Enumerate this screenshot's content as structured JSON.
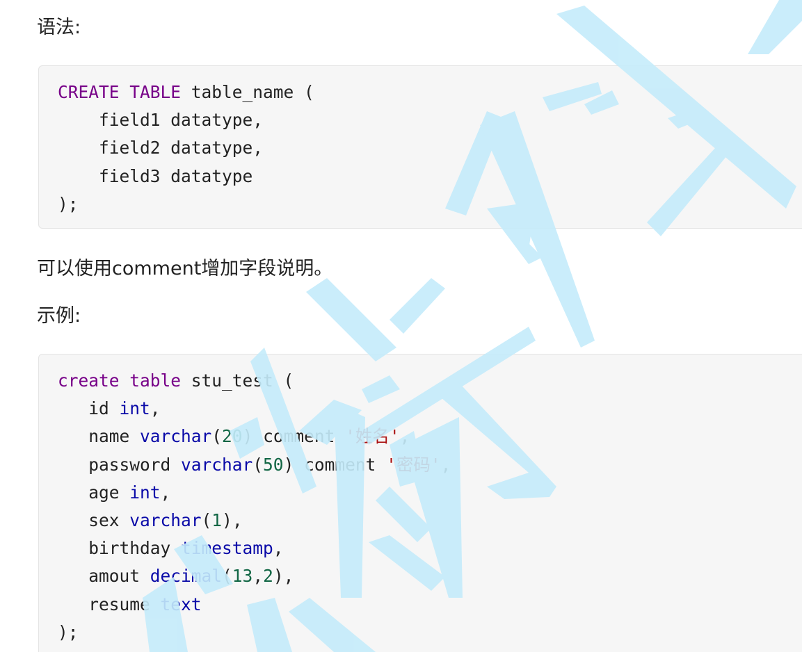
{
  "syntax_heading": "语法:",
  "syntax_code": {
    "line1": {
      "kw1": "CREATE",
      "kw2": "TABLE",
      "rest": " table_name ("
    },
    "line2": "    field1 datatype,",
    "line3": "    field2 datatype,",
    "line4": "    field3 datatype",
    "line5": ");"
  },
  "comment_note": "可以使用comment增加字段说明。",
  "example_heading": "示例:",
  "example_code": {
    "l1": {
      "kw1": "create",
      "kw2": "table",
      "rest": " stu_test ("
    },
    "l2": {
      "name": "   id ",
      "type": "int",
      "tail": ","
    },
    "l3": {
      "name": "   name ",
      "type": "varchar",
      "p1": "(",
      "num": "20",
      "p2": ") comment ",
      "str": "'姓名'",
      "tail": ","
    },
    "l4": {
      "name": "   password ",
      "type": "varchar",
      "p1": "(",
      "num": "50",
      "p2": ") comment ",
      "str": "'密码'",
      "tail": ","
    },
    "l5": {
      "name": "   age ",
      "type": "int",
      "tail": ","
    },
    "l6": {
      "name": "   sex ",
      "type": "varchar",
      "p1": "(",
      "num": "1",
      "p2": "),"
    },
    "l7": {
      "name": "   birthday ",
      "type": "timestamp",
      "tail": ","
    },
    "l8": {
      "name": "   amout ",
      "type": "decimal",
      "p1": "(",
      "num": "13",
      "comma": ",",
      "num2": "2",
      "p2": "),"
    },
    "l9": {
      "name": "   resume ",
      "type": "text"
    },
    "l10": ");"
  },
  "watermark_color": "#c5ecfb"
}
